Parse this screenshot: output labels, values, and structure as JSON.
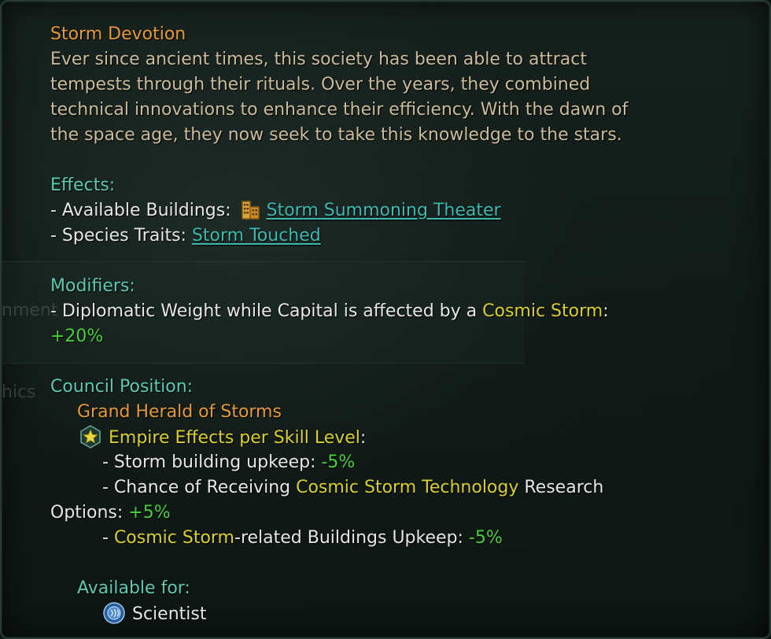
{
  "tooltip": {
    "title": "Storm Devotion",
    "description": [
      "Ever since ancient times, this society has been able to attract",
      "tempests through their rituals. Over the years, they combined",
      "technical innovations to enhance their efficiency. With the dawn of",
      "the space age, they now seek to take this knowledge to the stars."
    ],
    "effects": {
      "heading": "Effects:",
      "buildings_label": "- Available Buildings:",
      "buildings_icon": "building-icon",
      "buildings_link": "Storm Summoning Theater",
      "traits_label": "- Species Traits:",
      "traits_link": "Storm Touched"
    },
    "modifiers": {
      "heading": "Modifiers:",
      "line_prefix": "- Diplomatic Weight while Capital is affected by a ",
      "line_highlight": "Cosmic Storm",
      "line_suffix": ":",
      "value": "+20%"
    },
    "council": {
      "heading": "Council Position:",
      "position_name": "Grand Herald of Storms",
      "effects_icon": "star-icon",
      "effects_label": "Empire Effects per Skill Level",
      "effects_colon": ":",
      "upkeep_label": "- Storm building upkeep: ",
      "upkeep_value": "-5%",
      "chance_prefix": "- Chance of Receiving ",
      "chance_highlight": "Cosmic Storm Technology",
      "chance_suffix": " Research",
      "options_label": "Options: ",
      "options_value": "+5%",
      "related_dash": "- ",
      "related_highlight": "Cosmic Storm",
      "related_suffix": "-related Buildings Upkeep: ",
      "related_value": "-5%",
      "available_heading": "Available for:",
      "scientist_icon": "scientist-icon",
      "scientist_label": "Scientist"
    }
  },
  "background": {
    "ghost_left_1": "nment",
    "ghost_left_2": "hics"
  },
  "colors": {
    "title": "#e59a3a",
    "description": "#c9bb9c",
    "heading": "#5fc8b0",
    "link": "#3fb8b0",
    "highlight": "#d9d02d",
    "positive": "#47d13a"
  }
}
